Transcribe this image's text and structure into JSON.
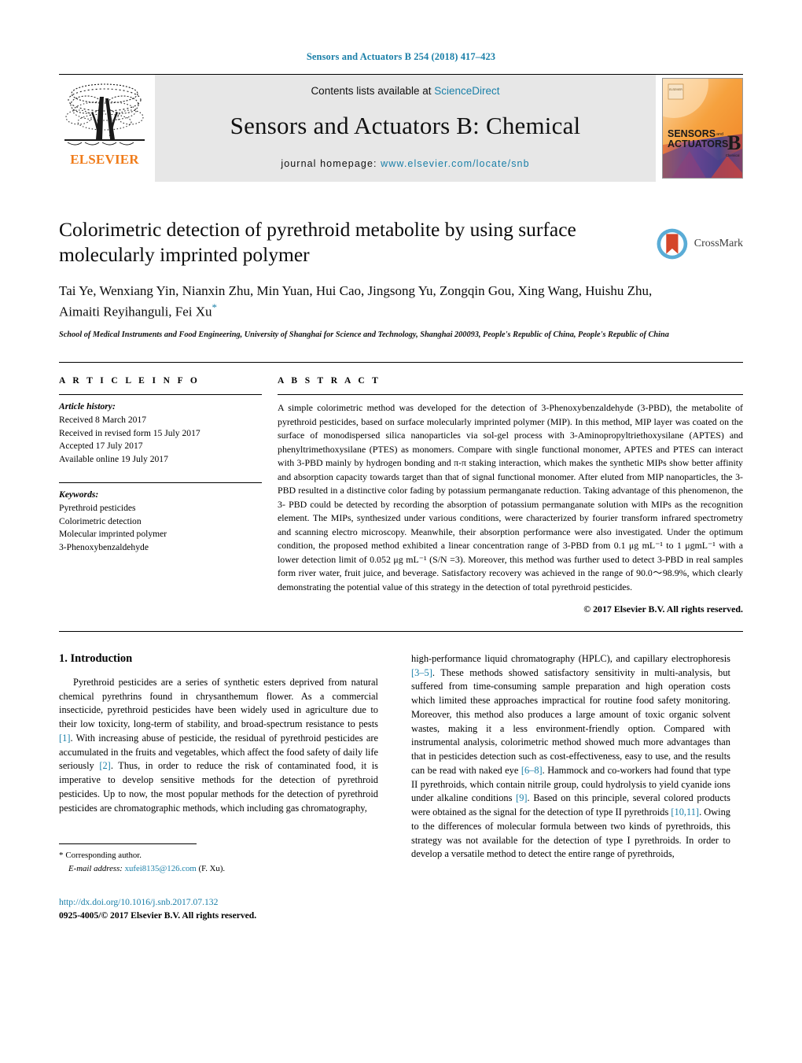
{
  "running_head": "Sensors and Actuators B 254 (2018) 417–423",
  "masthead": {
    "contents_prefix": "Contents lists available at ",
    "sciencedirect": "ScienceDirect",
    "journal_title": "Sensors and Actuators B: Chemical",
    "homepage_prefix": "journal homepage: ",
    "homepage_url": "www.elsevier.com/locate/snb",
    "publisher": "ELSEVIER",
    "cover_line1": "SENSORS",
    "cover_and": "and",
    "cover_line2": "ACTUATORS",
    "cover_letter": "B",
    "cover_sub": "Chemical"
  },
  "article": {
    "title": "Colorimetric detection of pyrethroid metabolite by using surface molecularly imprinted polymer",
    "authors": "Tai Ye, Wenxiang Yin, Nianxin Zhu, Min Yuan, Hui Cao, Jingsong Yu, Zongqin Gou, Xing Wang, Huishu Zhu, Aimaiti Reyihanguli, Fei Xu",
    "corresponding_marker": "*",
    "affiliation": "School of Medical Instruments and Food Engineering, University of Shanghai for Science and Technology, Shanghai 200093, People's Republic of China, People's Republic of China",
    "crossmark_label": "CrossMark"
  },
  "article_info": {
    "heading": "A R T I C L E    I N F O",
    "history_label": "Article history:",
    "history": [
      "Received 8 March 2017",
      "Received in revised form 15 July 2017",
      "Accepted 17 July 2017",
      "Available online 19 July 2017"
    ],
    "keywords_label": "Keywords:",
    "keywords": [
      "Pyrethroid pesticides",
      "Colorimetric detection",
      "Molecular imprinted polymer",
      "3-Phenoxybenzaldehyde"
    ]
  },
  "abstract": {
    "heading": "A B S T R A C T",
    "text": "A simple colorimetric method was developed for the detection of 3-Phenoxybenzaldehyde (3-PBD), the metabolite of pyrethroid pesticides, based on surface molecularly imprinted polymer (MIP). In this method, MIP layer was coated on the surface of monodispersed silica nanoparticles via sol-gel process with 3-Aminopropyltriethoxysilane (APTES) and phenyltrimethoxysilane (PTES) as monomers. Compare with single functional monomer, APTES and PTES can interact with 3-PBD mainly by hydrogen bonding and π-π staking interaction, which makes the synthetic MIPs show better affinity and absorption capacity towards target than that of signal functional monomer. After eluted from MIP nanoparticles, the 3- PBD resulted in a distinctive color fading by potassium permanganate reduction. Taking advantage of this phenomenon, the 3- PBD could be detected by recording the absorption of potassium permanganate solution with MIPs as the recognition element. The MIPs, synthesized under various conditions, were characterized by fourier transform infrared spectrometry and scanning electro microscopy. Meanwhile, their absorption performance were also investigated. Under the optimum condition, the proposed method exhibited a linear concentration range of 3-PBD from 0.1 μg mL⁻¹ to 1 μgmL⁻¹ with a lower detection limit of 0.052 μg mL⁻¹ (S/N =3). Moreover, this method was further used to detect 3-PBD in real samples form river water, fruit juice, and beverage. Satisfactory recovery was achieved in the range of 90.0～98.9%, which clearly demonstrating the potential value of this strategy in the detection of total pyrethroid pesticides.",
    "copyright": "© 2017 Elsevier B.V. All rights reserved."
  },
  "introduction": {
    "section_number": "1.",
    "section_title": "Introduction",
    "left_paragraph_a": "Pyrethroid pesticides are a series of synthetic esters deprived from natural chemical pyrethrins found in chrysanthemum flower. As a commercial insecticide, pyrethroid pesticides have been widely used in agriculture due to their low toxicity, long-term of stability, and broad-spectrum resistance to pests ",
    "ref1": "[1]",
    "left_paragraph_b": ". With increasing abuse of pesticide, the residual of pyrethroid pesticides are accumulated in the fruits and vegetables, which affect the food safety of daily life seriously ",
    "ref2": "[2]",
    "left_paragraph_c": ". Thus, in order to reduce the risk of contaminated food, it is imperative to develop sensitive methods for the detection of pyrethroid pesticides. Up to now, the most popular methods for the detection of pyrethroid pesticides are chromatographic methods, which including gas chromatography,",
    "right_paragraph_a": "high-performance liquid chromatography (HPLC), and capillary electrophoresis ",
    "ref35": "[3–5]",
    "right_paragraph_b": ". These methods showed satisfactory sensitivity in multi-analysis, but suffered from time-consuming sample preparation and high operation costs which limited these approaches impractical for routine food safety monitoring. Moreover, this method also produces a large amount of toxic organic solvent wastes, making it a less environment-friendly option. Compared with instrumental analysis, colorimetric method showed much more advantages than that in pesticides detection such as cost-effectiveness, easy to use, and the results can be read with naked eye ",
    "ref68": "[6–8]",
    "right_paragraph_c": ". Hammock and co-workers had found that type II pyrethroids, which contain nitrile group, could hydrolysis to yield cyanide ions under alkaline conditions ",
    "ref9": "[9]",
    "right_paragraph_d": ". Based on this principle, several colored products were obtained as the signal for the detection of type II pyrethroids ",
    "ref1011": "[10,11]",
    "right_paragraph_e": ". Owing to the differences of molecular formula between two kinds of pyrethroids, this strategy was not available for the detection of type I pyrethroids. In order to develop a versatile method to detect the entire range of pyrethroids,"
  },
  "footnote": {
    "star": "*",
    "corresponding": "Corresponding author.",
    "email_label": "E-mail address:",
    "email": "xufei8135@126.com",
    "email_suffix": "(F. Xu)."
  },
  "doi_footer": {
    "doi_url": "http://dx.doi.org/10.1016/j.snb.2017.07.132",
    "issn_line": "0925-4005/© 2017 Elsevier B.V. All rights reserved."
  },
  "colors": {
    "link": "#1a7fa8",
    "elsevier_orange": "#f07c1a",
    "band_grey": "#e7e7e7",
    "crossmark_blue": "#5aacd6",
    "crossmark_red": "#d4462a"
  }
}
